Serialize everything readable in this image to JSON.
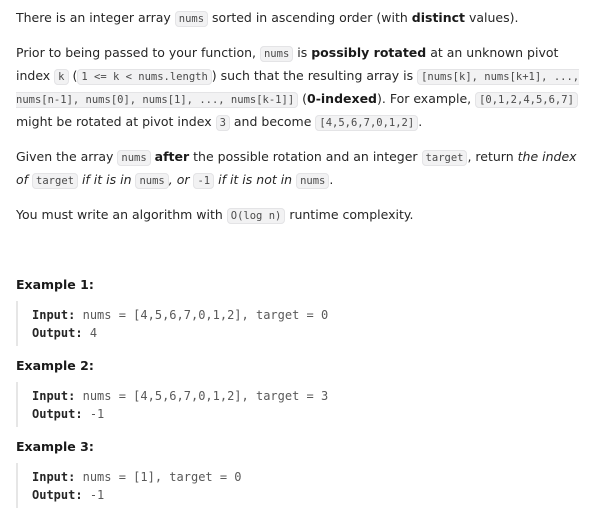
{
  "p1": {
    "t1": "There is an integer array ",
    "c1": "nums",
    "t2": " sorted in ascending order (with ",
    "b1": "distinct",
    "t3": " values)."
  },
  "p2": {
    "t1": "Prior to being passed to your function, ",
    "c1": "nums",
    "t2": " is ",
    "b1": "possibly rotated",
    "t3": " at an unknown pivot index ",
    "c2": "k",
    "t4": " (",
    "c3": "1 <= k < nums.length",
    "t5": ") such that the resulting array is ",
    "c4": "[nums[k], nums[k+1], ..., nums[n-1], nums[0], nums[1], ..., nums[k-1]]",
    "t6": " (",
    "b2": "0-indexed",
    "t7": "). For example, ",
    "c5": "[0,1,2,4,5,6,7]",
    "t8": " might be rotated at pivot index ",
    "c6": "3",
    "t9": " and become ",
    "c7": "[4,5,6,7,0,1,2]",
    "t10": "."
  },
  "p3": {
    "t1": "Given the array ",
    "c1": "nums",
    "t2": " ",
    "b1": "after",
    "t3": " the possible rotation and an integer ",
    "c2": "target",
    "t4": ", return ",
    "e1": "the index of ",
    "c3": "target",
    "e2": " if it is in ",
    "c4": "nums",
    "e3": ", or ",
    "c5": "-1",
    "e4": " if it is not in ",
    "c6": "nums",
    "t5": "."
  },
  "p4": {
    "t1": "You must write an algorithm with ",
    "c1": "O(log n)",
    "t2": " runtime complexity."
  },
  "examples": [
    {
      "title": "Example 1:",
      "input_label": "Input:",
      "input": "nums = [4,5,6,7,0,1,2], target = 0",
      "output_label": "Output:",
      "output": "4"
    },
    {
      "title": "Example 2:",
      "input_label": "Input:",
      "input": "nums = [4,5,6,7,0,1,2], target = 3",
      "output_label": "Output:",
      "output": "-1"
    },
    {
      "title": "Example 3:",
      "input_label": "Input:",
      "input": "nums = [1], target = 0",
      "output_label": "Output:",
      "output": "-1"
    }
  ]
}
